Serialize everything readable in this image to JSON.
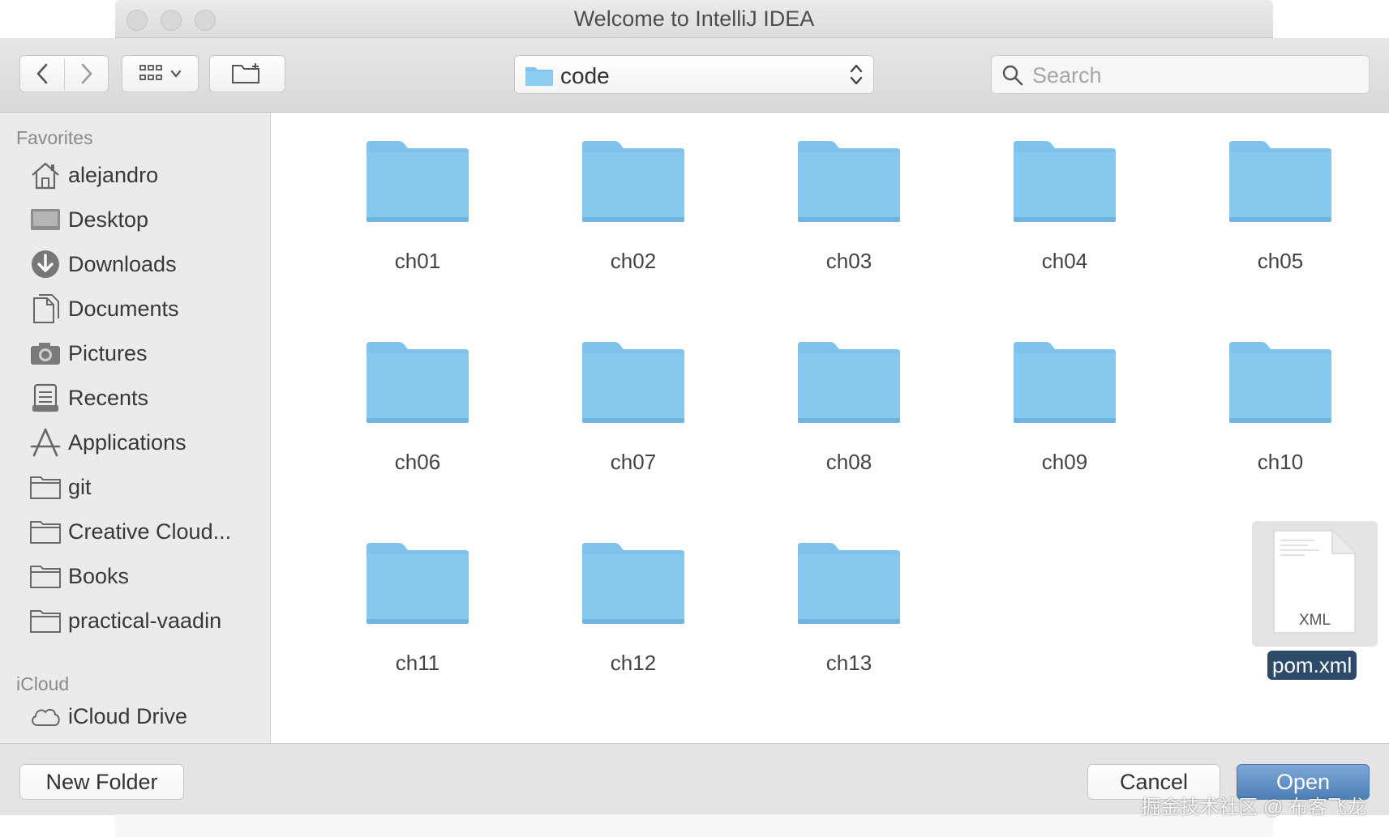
{
  "window": {
    "title": "Welcome to IntelliJ IDEA"
  },
  "toolbar": {
    "back_icon": "chevron-left-icon",
    "forward_icon": "chevron-right-icon",
    "view_icon": "icon-grid-icon",
    "new_folder_icon": "folder-plus-icon",
    "path": "code",
    "search_placeholder": "Search"
  },
  "sidebar": {
    "favorites_label": "Favorites",
    "favorites": [
      {
        "label": "alejandro",
        "icon": "home-icon"
      },
      {
        "label": "Desktop",
        "icon": "desktop-icon"
      },
      {
        "label": "Downloads",
        "icon": "downloads-icon"
      },
      {
        "label": "Documents",
        "icon": "documents-icon"
      },
      {
        "label": "Pictures",
        "icon": "camera-icon"
      },
      {
        "label": "Recents",
        "icon": "recents-icon"
      },
      {
        "label": "Applications",
        "icon": "applications-icon"
      },
      {
        "label": "git",
        "icon": "folder-icon"
      },
      {
        "label": "Creative Cloud...",
        "icon": "folder-icon"
      },
      {
        "label": "Books",
        "icon": "folder-icon"
      },
      {
        "label": "practical-vaadin",
        "icon": "folder-icon"
      }
    ],
    "icloud_label": "iCloud",
    "icloud": [
      {
        "label": "iCloud Drive",
        "icon": "cloud-icon"
      }
    ]
  },
  "files": {
    "folders": [
      "ch01",
      "ch02",
      "ch03",
      "ch04",
      "ch05",
      "ch06",
      "ch07",
      "ch08",
      "ch09",
      "ch10",
      "ch11",
      "ch12",
      "ch13"
    ],
    "selected_file": {
      "name": "pom.xml",
      "badge": "XML"
    }
  },
  "buttons": {
    "new_folder": "New Folder",
    "cancel": "Cancel",
    "open": "Open"
  },
  "watermark": "掘金技术社区 @ 布客飞龙",
  "colors": {
    "folder": "#7fc3ec",
    "selection": "#2e4a6b",
    "default_button": "#4d7fb6"
  }
}
